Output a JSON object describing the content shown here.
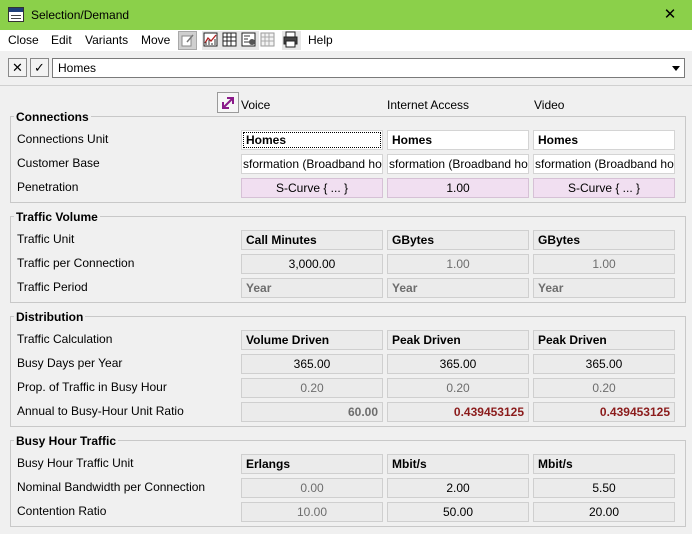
{
  "window": {
    "title": "Selection/Demand",
    "close_glyph": "✕"
  },
  "menu": {
    "items": [
      "Close",
      "Edit",
      "Variants",
      "Move"
    ],
    "help": "Help"
  },
  "toolbar_icons": [
    "edit-icon",
    "chart-icon",
    "table-icon",
    "map-icon",
    "grid-icon",
    "print-icon"
  ],
  "selector": {
    "value": "Homes",
    "cancel_glyph": "✕",
    "ok_glyph": "✓"
  },
  "columns": [
    "Voice",
    "Internet Access",
    "Video"
  ],
  "sections": {
    "connections": {
      "title": "Connections",
      "rows": {
        "unit": {
          "label": "Connections Unit",
          "values": [
            "Homes",
            "Homes",
            "Homes"
          ]
        },
        "base": {
          "label": "Customer Base",
          "values": [
            "sformation (Broadband ho",
            "sformation (Broadband ho",
            "sformation (Broadband ho"
          ]
        },
        "penetration": {
          "label": "Penetration",
          "values": [
            "S-Curve { ... }",
            "1.00",
            "S-Curve { ... }"
          ]
        }
      }
    },
    "traffic": {
      "title": "Traffic Volume",
      "rows": {
        "unit": {
          "label": "Traffic Unit",
          "values": [
            "Call Minutes",
            "GBytes",
            "GBytes"
          ]
        },
        "per_conn": {
          "label": "Traffic per Connection",
          "values": [
            "3,000.00",
            "1.00",
            "1.00"
          ]
        },
        "period": {
          "label": "Traffic Period",
          "values": [
            "Year",
            "Year",
            "Year"
          ]
        }
      }
    },
    "distribution": {
      "title": "Distribution",
      "rows": {
        "calc": {
          "label": "Traffic Calculation",
          "values": [
            "Volume Driven",
            "Peak Driven",
            "Peak Driven"
          ]
        },
        "busy_days": {
          "label": "Busy Days per Year",
          "values": [
            "365.00",
            "365.00",
            "365.00"
          ]
        },
        "prop": {
          "label": "Prop. of Traffic in Busy Hour",
          "values": [
            "0.20",
            "0.20",
            "0.20"
          ]
        },
        "ratio": {
          "label": "Annual to Busy-Hour Unit Ratio",
          "values": [
            "60.00",
            "0.439453125",
            "0.439453125"
          ]
        }
      }
    },
    "busy": {
      "title": "Busy Hour Traffic",
      "rows": {
        "unit": {
          "label": "Busy Hour Traffic Unit",
          "values": [
            "Erlangs",
            "Mbit/s",
            "Mbit/s"
          ]
        },
        "bandwidth": {
          "label": "Nominal Bandwidth per Connection",
          "values": [
            "0.00",
            "2.00",
            "5.50"
          ]
        },
        "contention": {
          "label": "Contention Ratio",
          "values": [
            "10.00",
            "50.00",
            "20.00"
          ]
        }
      }
    }
  }
}
